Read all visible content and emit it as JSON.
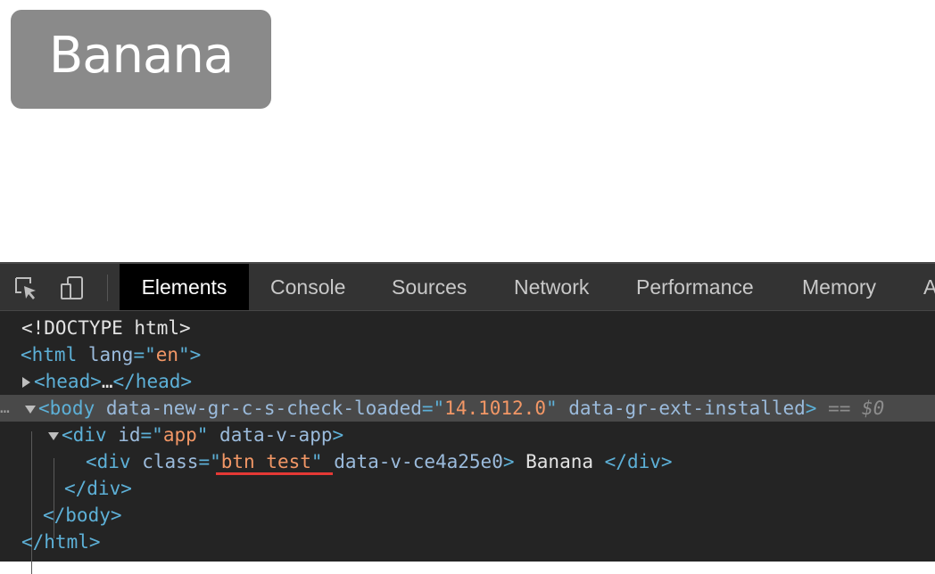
{
  "page": {
    "button_label": "Banana"
  },
  "devtools": {
    "tabs": [
      "Elements",
      "Console",
      "Sources",
      "Network",
      "Performance",
      "Memory",
      "A"
    ],
    "active_tab": "Elements",
    "tree": {
      "doctype": "<!DOCTYPE html>",
      "html_open": "<html",
      "html_attr": " lang",
      "html_eq": "=\"",
      "html_lang": "en",
      "html_close": "\">",
      "head": "<head>",
      "head_ellipsis": "…",
      "head_close": "</head>",
      "body_open": "<body",
      "body_attr1": " data-new-gr-c-s-check-loaded",
      "body_eq": "=\"",
      "body_attr1_val": "14.1012.0",
      "body_q": "\"",
      "body_attr2": " data-gr-ext-installed",
      "body_close": ">",
      "selected_marker": " == $0",
      "div_app_open": "<div",
      "div_app_attr": " id",
      "div_app_val": "app",
      "div_app_attr2": " data-v-app",
      "div_app_close": ">",
      "div_btn_open": "<div",
      "div_btn_attr": " class",
      "div_btn_val": "btn test",
      "div_btn_attr2": " data-v-ce4a25e0",
      "div_btn_close": ">",
      "div_btn_text": " Banana ",
      "div_btn_end": "</div>",
      "div_end": "</div>",
      "body_end": "</body>",
      "html_end": "</html>"
    }
  },
  "colors": {
    "tag": "#5db0d7",
    "attr": "#9bbbdc",
    "value": "#f29766",
    "highlight_underline": "#e53935"
  }
}
